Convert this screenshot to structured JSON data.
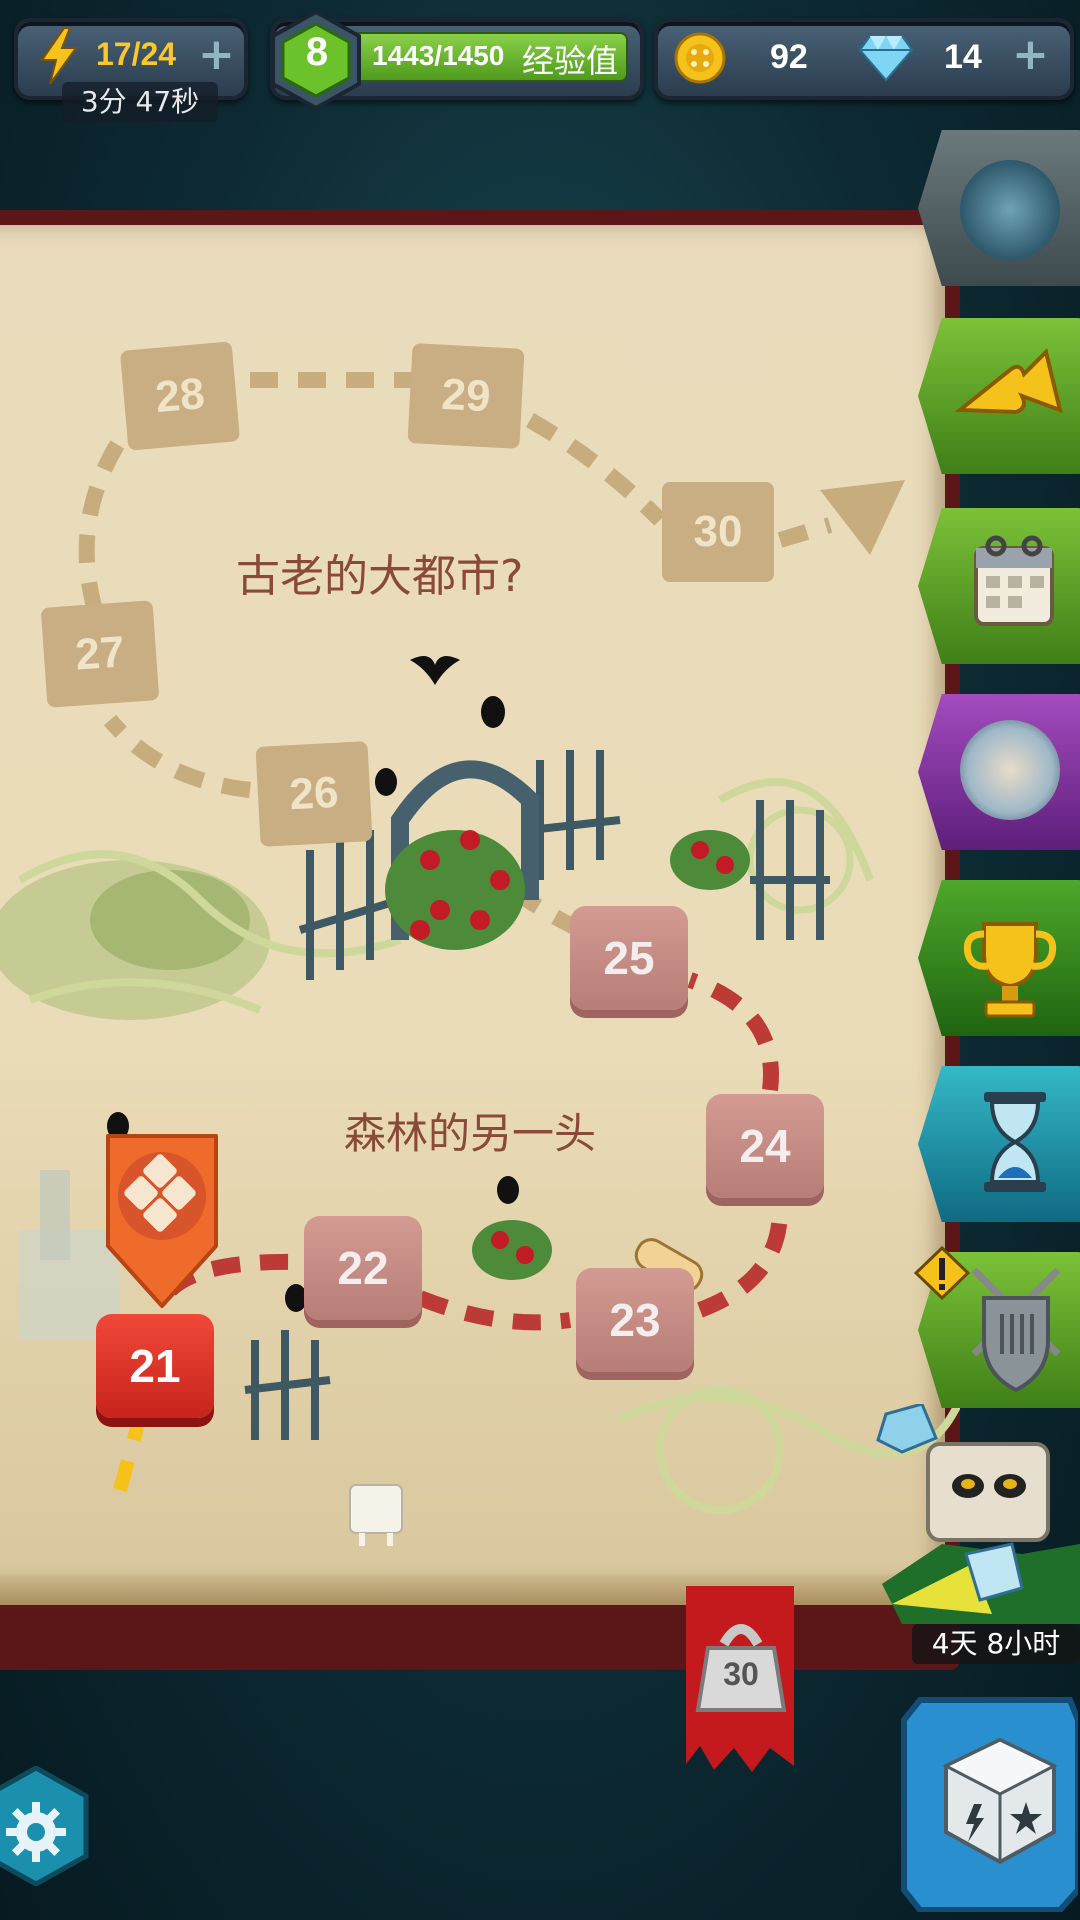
{
  "hud": {
    "energy": "17/24",
    "energy_timer": "3分 47秒",
    "level": "8",
    "xp": "1443/1450",
    "xp_label": "经验值",
    "coins": "92",
    "gems": "14"
  },
  "map": {
    "region_top_label": "古老的大都市?",
    "region_bottom_label": "森林的另一头",
    "levels_locked": [
      "26",
      "27",
      "28",
      "29",
      "30"
    ],
    "levels_open": [
      "22",
      "23",
      "24",
      "25"
    ],
    "current_level": "21"
  },
  "bookmark_value": "30",
  "event_timer": "4天 8小时",
  "colors": {
    "hud_panel": "#34495e",
    "xp_green": "#63b52b",
    "gold": "#f4c21b",
    "tile_red": "#d8261e",
    "tile_rose": "#c28a84",
    "tile_tan": "#c9ae83",
    "book_page": "#eadcb8"
  }
}
